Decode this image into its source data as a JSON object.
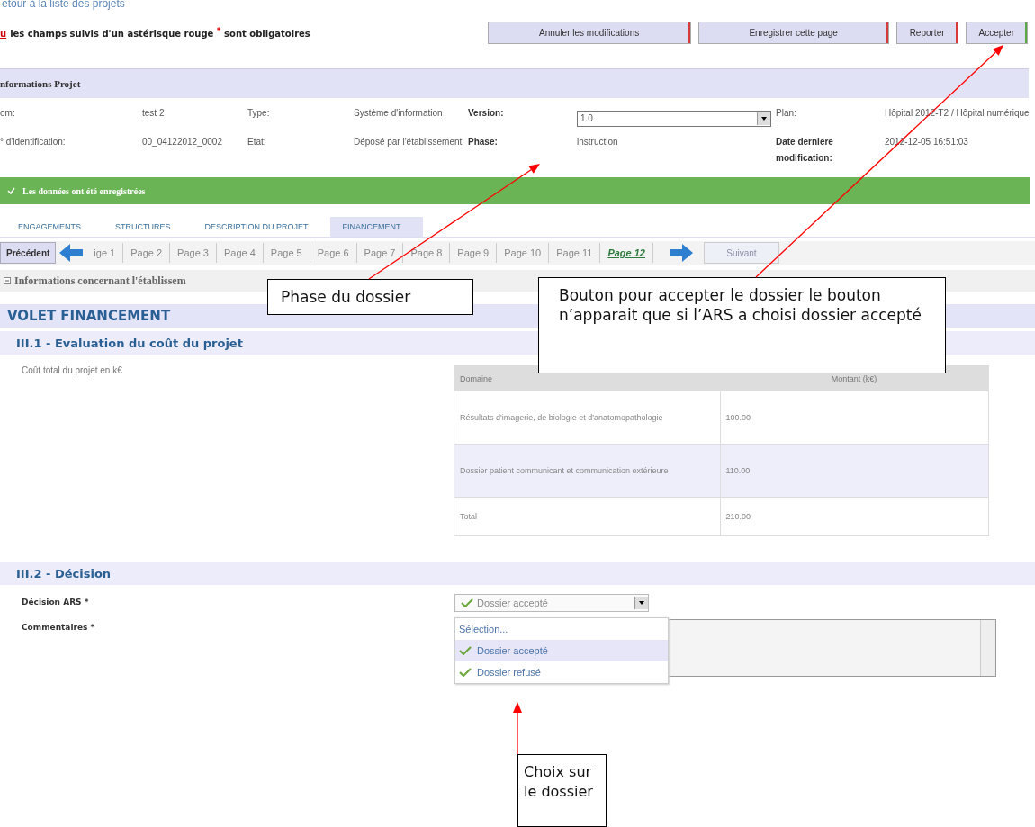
{
  "top_link": "etour à la liste des projets",
  "required_note": {
    "marker": "u",
    "text": "les champs suivis d'un astérisque rouge $^{*}$ sont obligatoires"
  },
  "buttons": [
    {
      "label": "Annuler les modifications",
      "color": "#d83a3a"
    },
    {
      "label": "Enregistrer cette page",
      "color": "#d83a3a"
    },
    {
      "label": "Reporter",
      "color": "#d83a3a"
    },
    {
      "label": "Accepter",
      "color": "#5aa846"
    }
  ],
  "info_panel": {
    "title": "nformations Projet",
    "rows": [
      [
        {
          "kind": "label",
          "text": "om:"
        },
        {
          "kind": "value",
          "text": "test 2"
        },
        {
          "kind": "label",
          "text": "Type:"
        },
        {
          "kind": "value",
          "text": "Système d'information"
        },
        {
          "kind": "strong",
          "text": "Version:"
        },
        {
          "kind": "select",
          "text": "1.0"
        },
        {
          "kind": "label",
          "text": "Plan:"
        },
        {
          "kind": "value",
          "text": "Hôpital 2012-T2 / Hôpital numérique"
        }
      ],
      [
        {
          "kind": "label",
          "text": "° d'identification:"
        },
        {
          "kind": "value",
          "text": "00_04122012_0002"
        },
        {
          "kind": "label",
          "text": "Etat:"
        },
        {
          "kind": "value",
          "text": "Déposé par l'établissement"
        },
        {
          "kind": "strong",
          "text": "Phase:"
        },
        {
          "kind": "value",
          "text": "instruction"
        },
        {
          "kind": "strong",
          "text": "Date derniere modification:"
        },
        {
          "kind": "value",
          "text": "2012-12-05 16:51:03"
        }
      ]
    ]
  },
  "notice": "Les données ont été enregistrées",
  "tabs": [
    {
      "label": "ENGAGEMENTS",
      "selected": false
    },
    {
      "label": "STRUCTURES",
      "selected": false
    },
    {
      "label": "DESCRIPTION DU PROJET",
      "selected": false
    },
    {
      "label": "FINANCEMENT",
      "selected": true
    }
  ],
  "pager": {
    "previous": "Précédent",
    "pages": [
      {
        "label": "ige 1",
        "selected": false
      },
      {
        "label": "Page 2",
        "selected": false
      },
      {
        "label": "Page 3",
        "selected": false
      },
      {
        "label": "Page 4",
        "selected": false
      },
      {
        "label": "Page 5",
        "selected": false
      },
      {
        "label": "Page 6",
        "selected": false
      },
      {
        "label": "Page 7",
        "selected": false
      },
      {
        "label": "Page 8",
        "selected": false
      },
      {
        "label": "Page 9",
        "selected": false
      },
      {
        "label": "Page 10",
        "selected": false
      },
      {
        "label": "Page 11",
        "selected": false
      },
      {
        "label": "Page 12",
        "selected": true
      }
    ],
    "next": {
      "label": "Suivant",
      "disabled": true
    }
  },
  "section_header": "Informations concernant l'établissem",
  "volet_title": "VOLET FINANCEMENT",
  "cost_section": {
    "title": "III.1 - Evaluation du coût du projet",
    "label": "Coût total du projet en k€",
    "table": {
      "columns": [
        "Domaine",
        "Montant (k€)"
      ],
      "rows": [
        [
          "Résultats d'imagerie, de biologie et d'anatomopathologie",
          "100.00"
        ],
        [
          "Dossier patient communicant et communication extérieure",
          "110.00"
        ],
        [
          "Total",
          "210.00"
        ]
      ]
    }
  },
  "decision_section": {
    "title": "III.2 - Décision",
    "decision": {
      "label": "Décision ARS *",
      "value": "Dossier accepté",
      "options": [
        {
          "kind": "placeholder",
          "label": "Sélection...",
          "selected": false
        },
        {
          "kind": "choice",
          "label": "Dossier accepté",
          "selected": true
        },
        {
          "kind": "choice",
          "label": "Dossier refusé",
          "selected": false
        }
      ]
    },
    "comments": {
      "label": "Commentaires *"
    }
  },
  "callouts": [
    {
      "text": "Phase du dossier"
    },
    {
      "text": "Bouton pour accepter le dossier le bouton n’apparait que si l’ARS a choisi dossier accepté"
    },
    {
      "text": "Choix sur le dossier"
    }
  ]
}
